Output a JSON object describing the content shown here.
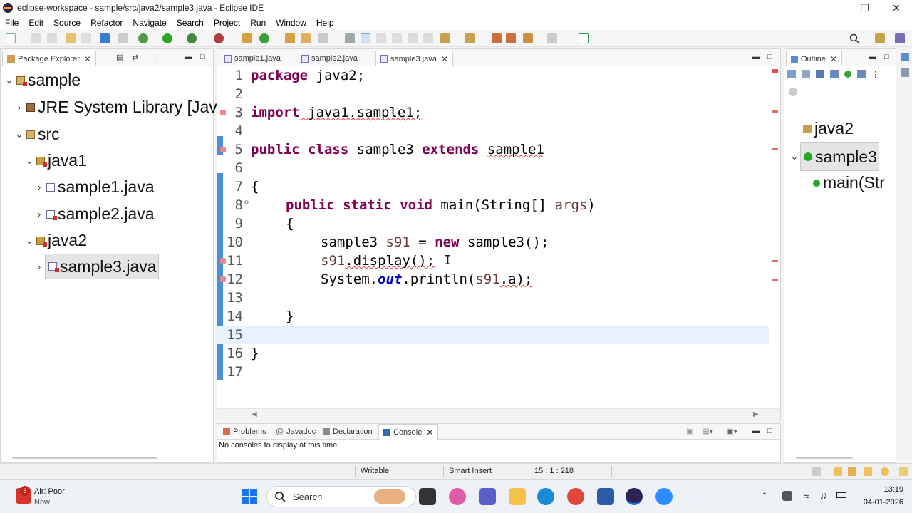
{
  "window": {
    "title": "eclipse-workspace - sample/src/java2/sample3.java - Eclipse IDE"
  },
  "menu": [
    "File",
    "Edit",
    "Source",
    "Refactor",
    "Navigate",
    "Search",
    "Project",
    "Run",
    "Window",
    "Help"
  ],
  "package_explorer": {
    "title": "Package Explorer",
    "tree": [
      {
        "label": "sample",
        "level": 0,
        "expanded": true,
        "icon": "project-icon"
      },
      {
        "label": "JRE System Library [Jav",
        "level": 1,
        "expanded": false,
        "icon": "library-icon"
      },
      {
        "label": "src",
        "level": 1,
        "expanded": true,
        "icon": "source-folder-icon"
      },
      {
        "label": "java1",
        "level": 2,
        "expanded": true,
        "icon": "package-icon"
      },
      {
        "label": "sample1.java",
        "level": 3,
        "expanded": false,
        "icon": "java-file-icon"
      },
      {
        "label": "sample2.java",
        "level": 3,
        "expanded": false,
        "icon": "java-file-icon"
      },
      {
        "label": "java2",
        "level": 2,
        "expanded": true,
        "icon": "package-icon"
      },
      {
        "label": "sample3.java",
        "level": 3,
        "expanded": false,
        "icon": "java-file-icon",
        "selected": true
      }
    ]
  },
  "editor": {
    "tabs": [
      {
        "label": "sample1.java"
      },
      {
        "label": "sample2.java"
      },
      {
        "label": "sample3.java",
        "active": true
      }
    ],
    "line_numbers": [
      "1",
      "2",
      "3",
      "4",
      "5",
      "6",
      "7",
      "8",
      "9",
      "10",
      "11",
      "12",
      "13",
      "14",
      "15",
      "16",
      "17"
    ],
    "code": {
      "l1_kw": "package",
      "l1_rest": " java2;",
      "l3_kw": "import",
      "l3_rest": " java1.sample1;",
      "l5_kw1": "public",
      "l5_kw2": "class",
      "l5_name": "sample3",
      "l5_kw3": "extends",
      "l5_super": "sample1",
      "l7": "{",
      "l8_kw1": "public",
      "l8_kw2": "static",
      "l8_kw3": "void",
      "l8_sig": "main(String[] ",
      "l8_args": "args",
      "l8_end": ")",
      "l9": "{",
      "l10_type": "sample3 ",
      "l10_var": "s91",
      "l10_eq": " = ",
      "l10_kw": "new",
      "l10_rest": " sample3();",
      "l11_var": "s91",
      "l11_rest": ".display();",
      "l12_a": "System.",
      "l12_out": "out",
      "l12_b": ".println(",
      "l12_var": "s91",
      "l12_c": ".a);",
      "l14": "}",
      "l16": "}"
    }
  },
  "outline": {
    "title": "Outline",
    "items": [
      "java2",
      "sample3",
      "main(Str"
    ]
  },
  "bottom_panel": {
    "tabs": [
      "Problems",
      "Javadoc",
      "Declaration",
      "Console"
    ],
    "message": "No consoles to display at this time."
  },
  "status_bar": {
    "mode": "Writable",
    "insert": "Smart Insert",
    "position": "15 : 1 : 218"
  },
  "taskbar": {
    "weather_label": "Air: Poor",
    "weather_sub": "Now",
    "weather_badge": "8",
    "search_placeholder": "Search",
    "time": "13:19",
    "date": "04-01-2026"
  }
}
